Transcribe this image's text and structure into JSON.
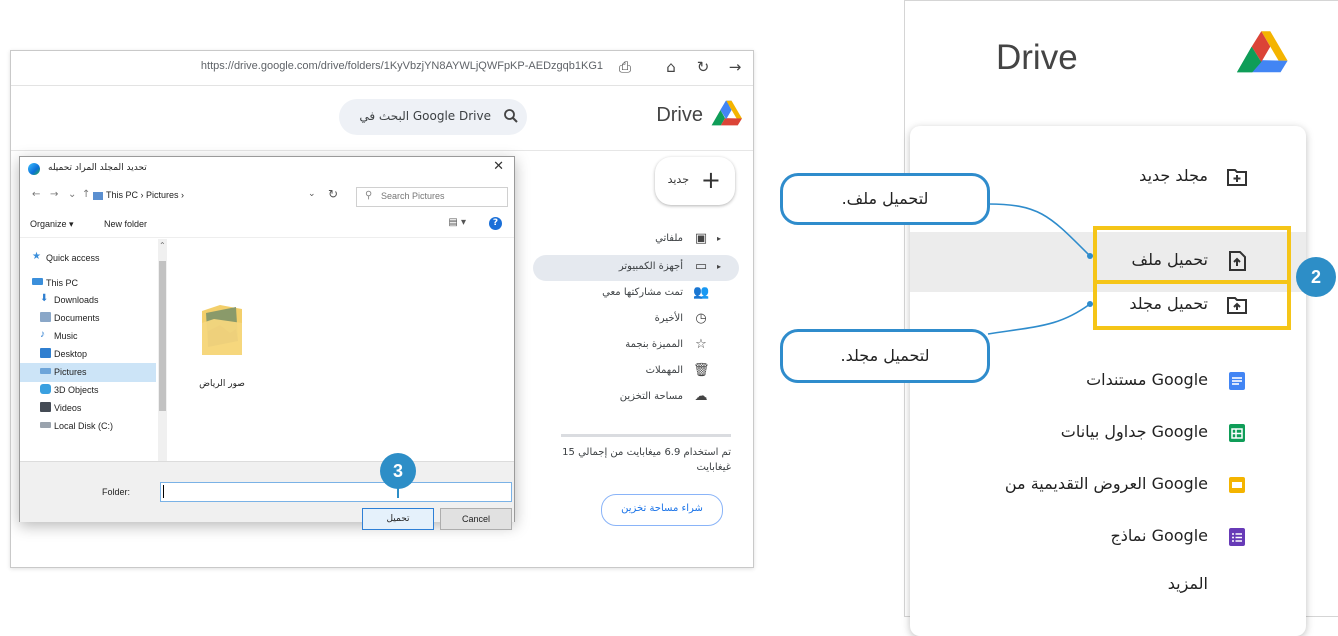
{
  "browser": {
    "url": "https://drive.google.com/drive/folders/1KyVbzjYN8AYWLjQWFpKP-AEDzgqb1KG1",
    "search_placeholder": "البحث في Google Drive",
    "logo_text": "Drive",
    "new_label": "جديد",
    "nav": [
      {
        "label": "ملفاتي",
        "icon": "drive-folder-icon"
      },
      {
        "label": "أجهزة الكمبيوتر",
        "icon": "computer-icon"
      },
      {
        "label": "تمت مشاركتها معي",
        "icon": "shared-people-icon"
      },
      {
        "label": "الأخيرة",
        "icon": "clock-icon"
      },
      {
        "label": "المميزة بنجمة",
        "icon": "star-icon"
      },
      {
        "label": "المهملات",
        "icon": "trash-icon"
      },
      {
        "label": "مساحة التخزين",
        "icon": "cloud-icon"
      }
    ],
    "storage_text": "تم استخدام 6.9 ميغابايت من إجمالي 15 غيغابايت",
    "buy_storage": "شراء مساحة تخزين"
  },
  "dialog": {
    "title": "تحديد المجلد المراد تحميله",
    "path": "This PC › Pictures ›",
    "path_prefix_icon": "pc-icon",
    "search_placeholder": "Search Pictures",
    "organize": "Organize ▾",
    "new_folder": "New folder",
    "tree": [
      {
        "label": "Quick access",
        "icon": "star-icon",
        "color": "#3b8fdb"
      },
      {
        "label": "This PC",
        "icon": "pc-icon",
        "color": "#3b8fdb"
      },
      {
        "label": "Downloads",
        "icon": "download-icon",
        "color": "#2f7fd0"
      },
      {
        "label": "Documents",
        "icon": "document-icon",
        "color": "#8aa7c8"
      },
      {
        "label": "Music",
        "icon": "music-icon",
        "color": "#2f7fd0"
      },
      {
        "label": "Desktop",
        "icon": "desktop-icon",
        "color": "#2f7fd0"
      },
      {
        "label": "Pictures",
        "icon": "pictures-icon",
        "color": "#6ea5d9"
      },
      {
        "label": "3D Objects",
        "icon": "cube-icon",
        "color": "#3aa0e0"
      },
      {
        "label": "Videos",
        "icon": "video-icon",
        "color": "#444b55"
      },
      {
        "label": "Local Disk (C:)",
        "icon": "disk-icon",
        "color": "#9aa3ad"
      }
    ],
    "folder_item": "صور الرياض",
    "folder_label": "Folder:",
    "upload_button": "تحميل",
    "cancel_button": "Cancel"
  },
  "steps": {
    "step2": "2",
    "step3": "3"
  },
  "panel": {
    "logo_text": "Drive",
    "menu": [
      {
        "label": "مجلد جديد",
        "icon": "new-folder-icon"
      },
      {
        "label": "تحميل ملف",
        "icon": "file-upload-icon"
      },
      {
        "label": "تحميل مجلد",
        "icon": "folder-upload-icon"
      },
      {
        "label": "مستندات Google",
        "icon": "google-docs-icon",
        "color": "#4285f4"
      },
      {
        "label": "جداول بيانات Google",
        "icon": "google-sheets-icon",
        "color": "#0f9d58"
      },
      {
        "label": "العروض التقديمية من Google",
        "icon": "google-slides-icon",
        "color": "#f4b400"
      },
      {
        "label": "نماذج Google",
        "icon": "google-forms-icon",
        "color": "#673ab7"
      },
      {
        "label": "المزيد",
        "icon": ""
      }
    ]
  },
  "callouts": {
    "upload_file": "لتحميل ملف.",
    "upload_folder": "لتحميل مجلد."
  },
  "colors": {
    "highlight": "#f5c518",
    "callout_border": "#2f8ccc",
    "badge": "#2d8ec7"
  }
}
